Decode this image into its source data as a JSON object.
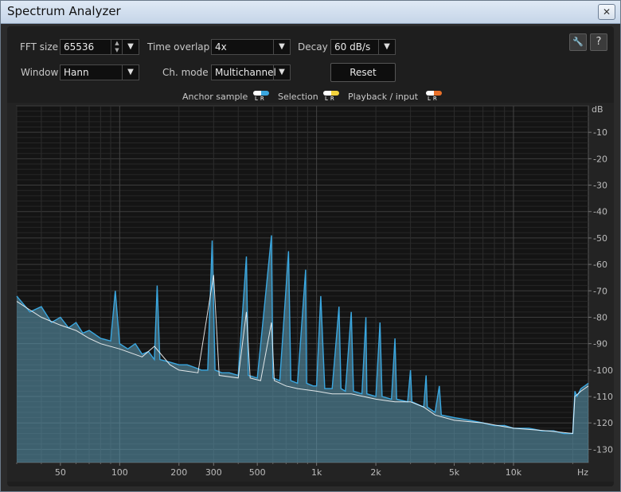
{
  "window": {
    "title": "Spectrum Analyzer",
    "close_glyph": "✕"
  },
  "controls": {
    "fft_size": {
      "label": "FFT size",
      "value": "65536"
    },
    "time_overlap": {
      "label": "Time overlap",
      "value": "4x"
    },
    "decay": {
      "label": "Decay",
      "value": "60 dB/s"
    },
    "window_fn": {
      "label": "Window",
      "value": "Hann"
    },
    "ch_mode": {
      "label": "Ch. mode",
      "value": "Multichannel"
    },
    "reset_label": "Reset",
    "dropdown_glyph": "▼",
    "spin_up": "▲",
    "spin_down": "▼",
    "wrench_glyph": "🔧",
    "help_glyph": "?"
  },
  "legend": {
    "anchor": {
      "label": "Anchor sample",
      "left_color": "#ffffff",
      "right_color": "#3aa7e0"
    },
    "selection": {
      "label": "Selection",
      "left_color": "#ffffff",
      "right_color": "#f2d23c"
    },
    "playback": {
      "label": "Playback / input",
      "left_color": "#ffffff",
      "right_color": "#e8702a"
    },
    "l": "L",
    "r": "R"
  },
  "chart_data": {
    "type": "line",
    "x_scale": "log",
    "xlim": [
      30,
      24000
    ],
    "ylim": [
      -135,
      0
    ],
    "y_unit": "dB",
    "x_unit": "Hz",
    "x_ticks": [
      {
        "v": 50,
        "label": "50"
      },
      {
        "v": 100,
        "label": "100"
      },
      {
        "v": 200,
        "label": "200"
      },
      {
        "v": 300,
        "label": "300"
      },
      {
        "v": 500,
        "label": "500"
      },
      {
        "v": 1000,
        "label": "1k"
      },
      {
        "v": 2000,
        "label": "2k"
      },
      {
        "v": 5000,
        "label": "5k"
      },
      {
        "v": 10000,
        "label": "10k"
      }
    ],
    "y_ticks": [
      -10,
      -20,
      -30,
      -40,
      -50,
      -60,
      -70,
      -80,
      -90,
      -100,
      -110,
      -120,
      -130
    ],
    "grid": true,
    "series": [
      {
        "channel": "R",
        "color": "#3aa7e0",
        "points": [
          [
            30,
            -72
          ],
          [
            35,
            -78
          ],
          [
            40,
            -76
          ],
          [
            45,
            -82
          ],
          [
            50,
            -80
          ],
          [
            55,
            -84
          ],
          [
            60,
            -82
          ],
          [
            65,
            -86
          ],
          [
            70,
            -85
          ],
          [
            80,
            -88
          ],
          [
            90,
            -89
          ],
          [
            95,
            -70
          ],
          [
            100,
            -90
          ],
          [
            110,
            -92
          ],
          [
            120,
            -90
          ],
          [
            130,
            -94
          ],
          [
            140,
            -93
          ],
          [
            150,
            -96
          ],
          [
            155,
            -68
          ],
          [
            160,
            -96
          ],
          [
            180,
            -97
          ],
          [
            200,
            -98
          ],
          [
            220,
            -98
          ],
          [
            240,
            -99
          ],
          [
            260,
            -100
          ],
          [
            280,
            -100
          ],
          [
            295,
            -51
          ],
          [
            305,
            -100
          ],
          [
            330,
            -101
          ],
          [
            360,
            -101
          ],
          [
            400,
            -102
          ],
          [
            440,
            -57
          ],
          [
            450,
            -102
          ],
          [
            500,
            -103
          ],
          [
            590,
            -49
          ],
          [
            600,
            -103
          ],
          [
            650,
            -104
          ],
          [
            720,
            -55
          ],
          [
            740,
            -104
          ],
          [
            800,
            -105
          ],
          [
            880,
            -62
          ],
          [
            890,
            -105
          ],
          [
            960,
            -106
          ],
          [
            1000,
            -106
          ],
          [
            1050,
            -72
          ],
          [
            1100,
            -107
          ],
          [
            1200,
            -107
          ],
          [
            1300,
            -76
          ],
          [
            1330,
            -107
          ],
          [
            1400,
            -108
          ],
          [
            1500,
            -78
          ],
          [
            1540,
            -108
          ],
          [
            1700,
            -109
          ],
          [
            1780,
            -80
          ],
          [
            1800,
            -109
          ],
          [
            2000,
            -110
          ],
          [
            2100,
            -82
          ],
          [
            2150,
            -110
          ],
          [
            2400,
            -111
          ],
          [
            2500,
            -88
          ],
          [
            2550,
            -111
          ],
          [
            2900,
            -112
          ],
          [
            3000,
            -100
          ],
          [
            3050,
            -112
          ],
          [
            3500,
            -114
          ],
          [
            3600,
            -102
          ],
          [
            3650,
            -114
          ],
          [
            4000,
            -116
          ],
          [
            4200,
            -106
          ],
          [
            4300,
            -117
          ],
          [
            5000,
            -118
          ],
          [
            6000,
            -119
          ],
          [
            7000,
            -120
          ],
          [
            8000,
            -121
          ],
          [
            9000,
            -121
          ],
          [
            10000,
            -122
          ],
          [
            12000,
            -122
          ],
          [
            14000,
            -123
          ],
          [
            16000,
            -123
          ],
          [
            18000,
            -124
          ],
          [
            20000,
            -124
          ],
          [
            20500,
            -108
          ],
          [
            21000,
            -110
          ],
          [
            22000,
            -107
          ],
          [
            23000,
            -106
          ],
          [
            24000,
            -105
          ]
        ]
      },
      {
        "channel": "L",
        "color": "#ffffff",
        "points": [
          [
            30,
            -74
          ],
          [
            40,
            -80
          ],
          [
            50,
            -83
          ],
          [
            60,
            -85
          ],
          [
            70,
            -88
          ],
          [
            80,
            -90
          ],
          [
            100,
            -92
          ],
          [
            130,
            -95
          ],
          [
            150,
            -91
          ],
          [
            180,
            -98
          ],
          [
            200,
            -100
          ],
          [
            250,
            -101
          ],
          [
            300,
            -64
          ],
          [
            320,
            -102
          ],
          [
            400,
            -103
          ],
          [
            440,
            -78
          ],
          [
            460,
            -103
          ],
          [
            520,
            -104
          ],
          [
            590,
            -82
          ],
          [
            610,
            -104
          ],
          [
            700,
            -106
          ],
          [
            800,
            -107
          ],
          [
            1000,
            -108
          ],
          [
            1200,
            -109
          ],
          [
            1500,
            -109
          ],
          [
            2000,
            -111
          ],
          [
            2500,
            -112
          ],
          [
            3000,
            -112
          ],
          [
            3500,
            -114
          ],
          [
            4000,
            -117
          ],
          [
            5000,
            -119
          ],
          [
            7000,
            -120
          ],
          [
            10000,
            -122
          ],
          [
            15000,
            -123
          ],
          [
            20000,
            -124
          ],
          [
            20500,
            -110
          ],
          [
            22000,
            -108
          ],
          [
            24000,
            -106
          ]
        ]
      }
    ]
  }
}
